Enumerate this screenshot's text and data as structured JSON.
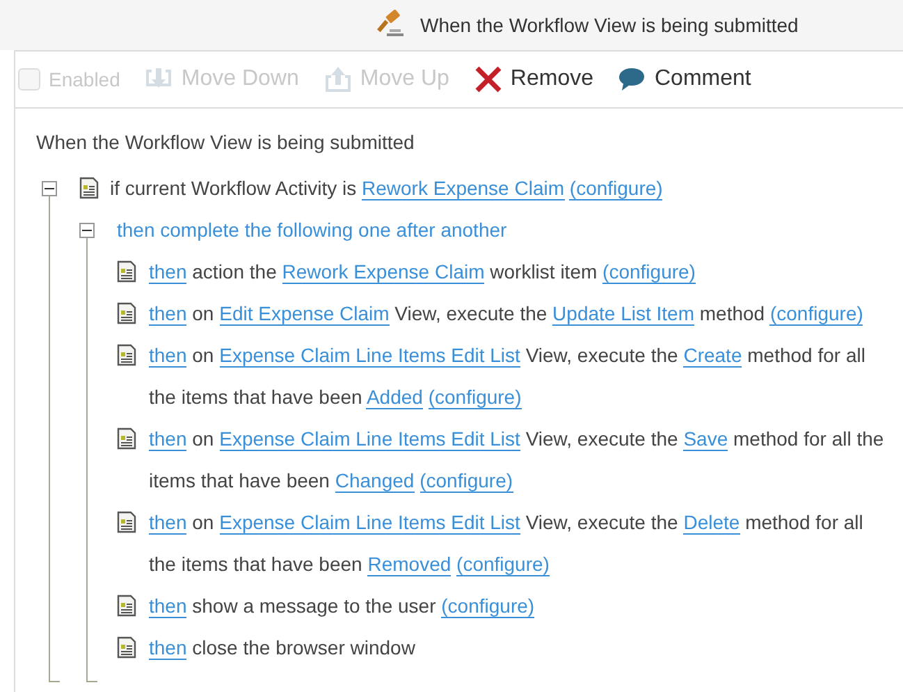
{
  "header": {
    "title": "When the Workflow View is being submitted"
  },
  "toolbar": [
    {
      "kind": "checkbox",
      "label": "Enabled",
      "checked": false,
      "disabled": true
    },
    {
      "kind": "move_down",
      "label": "Move Down",
      "disabled": true
    },
    {
      "kind": "move_up",
      "label": "Move Up",
      "disabled": true
    },
    {
      "kind": "remove",
      "label": "Remove",
      "disabled": false
    },
    {
      "kind": "comment",
      "label": "Comment",
      "disabled": false
    }
  ],
  "rule": {
    "title": "When the Workflow View is being submitted"
  },
  "tree": [
    {
      "kind": "condition",
      "expanded": true,
      "segments": [
        {
          "text": "if current Workflow Activity is",
          "link": false
        },
        {
          "text": "Rework Expense Claim",
          "link": true
        },
        {
          "text": "(configure)",
          "link": true
        }
      ],
      "children": [
        {
          "kind": "group",
          "expanded": true,
          "segments": [
            {
              "text": "then complete the following one after another",
              "link": false
            }
          ],
          "children": [
            {
              "kind": "action",
              "segments": [
                {
                  "text": "then",
                  "link": true
                },
                {
                  "text": "action the",
                  "link": false
                },
                {
                  "text": "Rework Expense Claim",
                  "link": true
                },
                {
                  "text": "worklist item",
                  "link": false
                },
                {
                  "text": "(configure)",
                  "link": true
                }
              ]
            },
            {
              "kind": "action",
              "segments": [
                {
                  "text": "then",
                  "link": true
                },
                {
                  "text": "on",
                  "link": false
                },
                {
                  "text": "Edit Expense Claim",
                  "link": true
                },
                {
                  "text": "View, execute the",
                  "link": false
                },
                {
                  "text": "Update List Item",
                  "link": true
                },
                {
                  "text": "method",
                  "link": false
                },
                {
                  "text": "(configure)",
                  "link": true
                }
              ]
            },
            {
              "kind": "action",
              "segments": [
                {
                  "text": "then",
                  "link": true
                },
                {
                  "text": "on",
                  "link": false
                },
                {
                  "text": "Expense Claim Line Items Edit List",
                  "link": true
                },
                {
                  "text": "View, execute the",
                  "link": false
                },
                {
                  "text": "Create",
                  "link": true
                },
                {
                  "text": "method for all",
                  "link": false
                },
                {
                  "text": "the items that have been",
                  "link": false
                },
                {
                  "text": "Added",
                  "link": true
                },
                {
                  "text": "(configure)",
                  "link": true
                }
              ]
            },
            {
              "kind": "action",
              "segments": [
                {
                  "text": "then",
                  "link": true
                },
                {
                  "text": "on",
                  "link": false
                },
                {
                  "text": "Expense Claim Line Items Edit List",
                  "link": true
                },
                {
                  "text": "View, execute the",
                  "link": false
                },
                {
                  "text": "Save",
                  "link": true
                },
                {
                  "text": "method for all the",
                  "link": false
                },
                {
                  "text": "items that have been",
                  "link": false
                },
                {
                  "text": "Changed",
                  "link": true
                },
                {
                  "text": "(configure)",
                  "link": true
                }
              ]
            },
            {
              "kind": "action",
              "segments": [
                {
                  "text": "then",
                  "link": true
                },
                {
                  "text": "on",
                  "link": false
                },
                {
                  "text": "Expense Claim Line Items Edit List",
                  "link": true
                },
                {
                  "text": "View, execute the",
                  "link": false
                },
                {
                  "text": "Delete",
                  "link": true
                },
                {
                  "text": "method for all",
                  "link": false
                },
                {
                  "text": "the items that have been",
                  "link": false
                },
                {
                  "text": "Removed",
                  "link": true
                },
                {
                  "text": "(configure)",
                  "link": true
                }
              ]
            },
            {
              "kind": "action",
              "segments": [
                {
                  "text": "then",
                  "link": true
                },
                {
                  "text": "show a message to the user",
                  "link": false
                },
                {
                  "text": "(configure)",
                  "link": true
                }
              ]
            },
            {
              "kind": "action",
              "segments": [
                {
                  "text": "then",
                  "link": true
                },
                {
                  "text": "close the browser window",
                  "link": false
                }
              ]
            }
          ]
        }
      ]
    }
  ]
}
